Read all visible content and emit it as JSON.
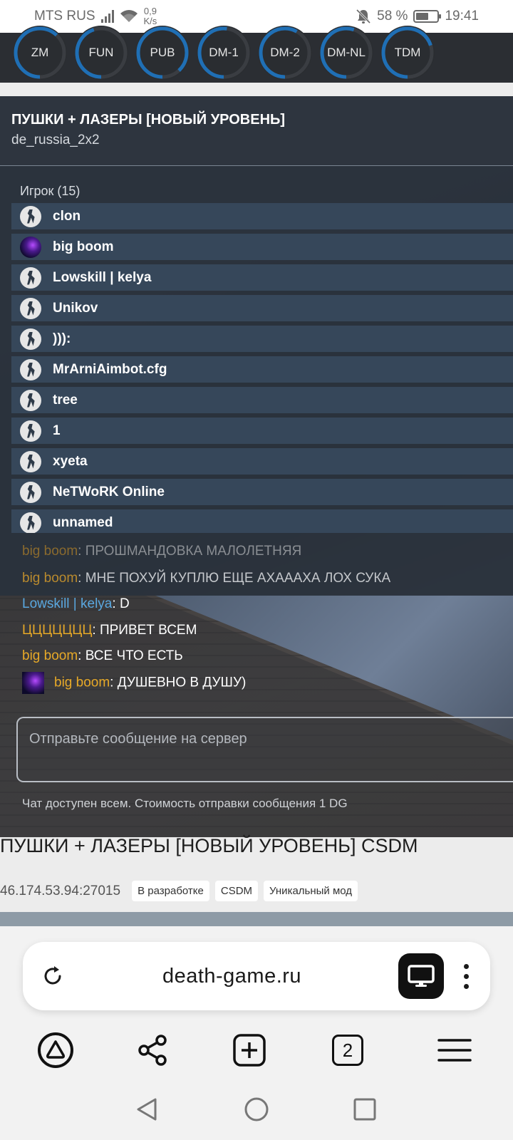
{
  "status_bar": {
    "carrier": "MTS RUS",
    "net_speed_value": "0,9",
    "net_speed_unit": "K/s",
    "battery": "58 %",
    "battery_level": 0.58,
    "time": "19:41"
  },
  "modes": [
    {
      "label": "ZM",
      "progress": 0.62
    },
    {
      "label": "FUN",
      "progress": 0.45
    },
    {
      "label": "PUB",
      "progress": 0.88
    },
    {
      "label": "DM-1",
      "progress": 0.52
    },
    {
      "label": "DM-2",
      "progress": 0.58
    },
    {
      "label": "DM-NL",
      "progress": 0.55
    },
    {
      "label": "TDM",
      "progress": 0.7
    }
  ],
  "server_panel": {
    "title": "ПУШКИ + ЛАЗЕРЫ [НОВЫЙ УРОВЕНЬ]",
    "map": "de_russia_2x2",
    "players_header": "Игрок (15)",
    "players": [
      {
        "name": "clon",
        "avatar": "cs-logo-icon"
      },
      {
        "name": "big boom",
        "avatar": "space-avatar"
      },
      {
        "name": "Lowskill | kelya",
        "avatar": "cs-logo-icon"
      },
      {
        "name": "Unikov",
        "avatar": "cs-logo-icon"
      },
      {
        "name": "))):",
        "avatar": "cs-logo-icon"
      },
      {
        "name": "MrArniAimbot.cfg",
        "avatar": "cs-logo-icon"
      },
      {
        "name": "tree",
        "avatar": "cs-logo-icon"
      },
      {
        "name": "1",
        "avatar": "cs-logo-icon"
      },
      {
        "name": "xyeta",
        "avatar": "cs-logo-icon"
      },
      {
        "name": "NeTWoRK Online",
        "avatar": "cs-logo-icon"
      },
      {
        "name": "unnamed",
        "avatar": "cs-logo-icon"
      }
    ],
    "chat": [
      {
        "author": "big boom",
        "sep": ": ",
        "text": "ПРОШМАНДОВКА МАЛОЛЕТНЯЯ"
      },
      {
        "author": "big boom",
        "sep": ": ",
        "text": "МНЕ ПОХУЙ КУПЛЮ ЕЩЕ АХАААХА ЛОХ СУКА"
      },
      {
        "author": "Lowskill | kelya",
        "sep": ": ",
        "text": "D"
      },
      {
        "author": "ЦЦЦЦЦЦЦ",
        "sep": ": ",
        "text": "ПРИВЕТ ВСЕМ"
      },
      {
        "author": "big boom",
        "sep": ": ",
        "text": "ВСЕ ЧТО ЕСТЬ"
      },
      {
        "author": "big boom",
        "sep": ": ",
        "text": "ДУШЕВНО В ДУШУ)"
      }
    ],
    "send_placeholder": "Отправьте сообщение на сервер",
    "chat_note": "Чат доступен всем. Стоимость отправки сообщения 1 DG"
  },
  "server_info": {
    "title": "ПУШКИ + ЛАЗЕРЫ [НОВЫЙ УРОВЕНЬ] CSDM",
    "ip": "46.174.53.94:27015",
    "tags": [
      "В разработке",
      "CSDM",
      "Уникальный мод"
    ]
  },
  "browser": {
    "url": "death-game.ru",
    "tab_count": "2"
  },
  "colors": {
    "mode_ring": "#1f6fb5",
    "chat_author": "#e7a928",
    "chat_author_alt": "#5aa8e0"
  }
}
